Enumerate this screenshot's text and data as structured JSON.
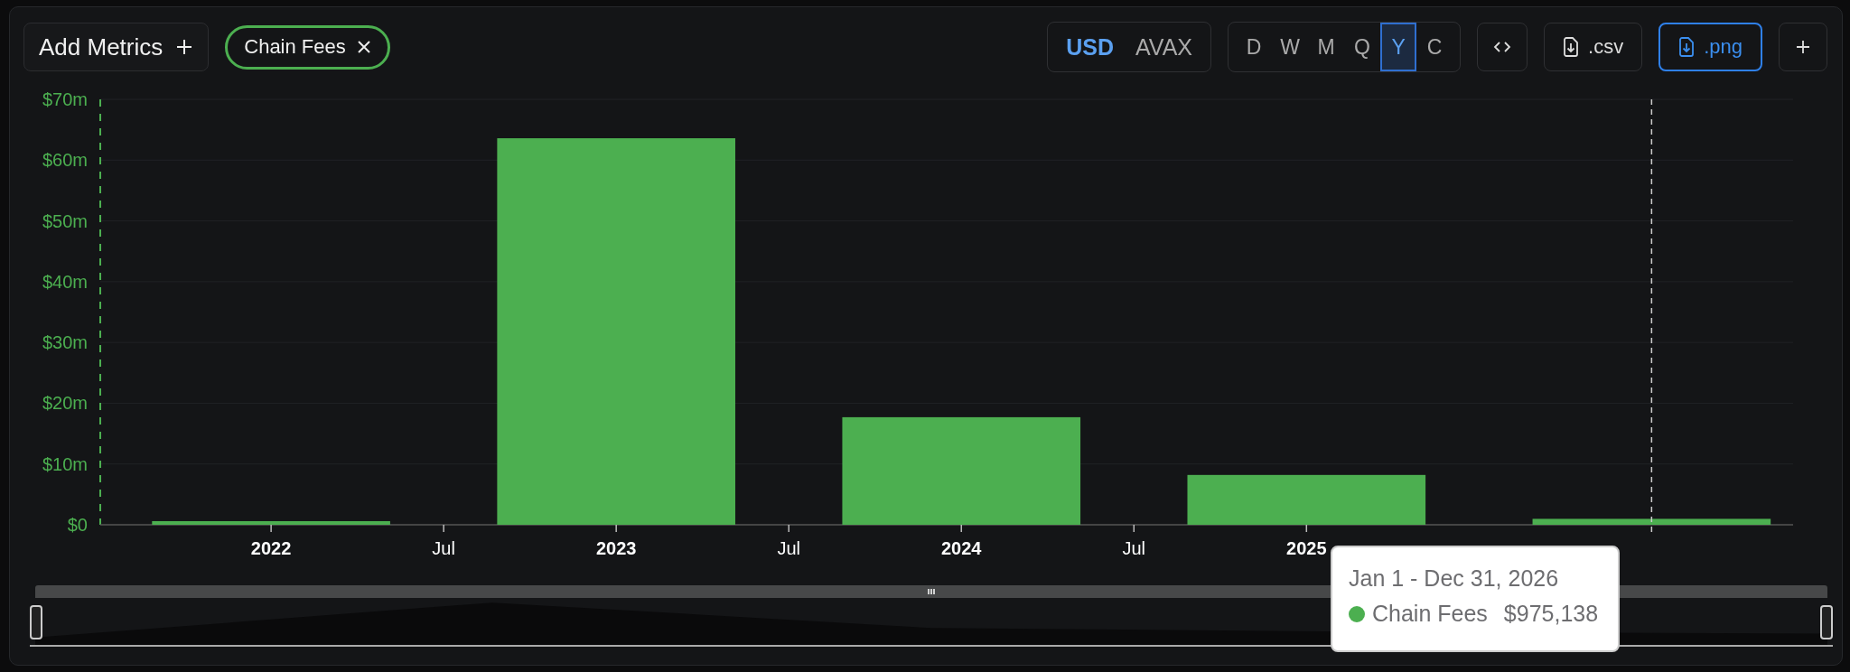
{
  "toolbar": {
    "add_metrics": {
      "label": "Add Metrics"
    },
    "metric_chips": [
      {
        "label": "Chain Fees",
        "color": "#4caf50"
      }
    ],
    "currency_toggle": [
      {
        "label": "USD",
        "selected": true
      },
      {
        "label": "AVAX",
        "selected": false
      }
    ],
    "period_toggle": [
      {
        "label": "D",
        "selected": false
      },
      {
        "label": "W",
        "selected": false
      },
      {
        "label": "M",
        "selected": false
      },
      {
        "label": "Q",
        "selected": false
      },
      {
        "label": "Y",
        "selected": true
      },
      {
        "label": "C",
        "selected": false
      }
    ],
    "actions": [
      {
        "kind": "embed",
        "selected": false
      },
      {
        "kind": "csv",
        "label": ".csv",
        "selected": false
      },
      {
        "kind": "png",
        "label": ".png",
        "selected": true
      },
      {
        "kind": "add",
        "selected": false
      }
    ]
  },
  "chart": {
    "chart_data": {
      "type": "bar",
      "x": [
        2022,
        2023,
        2024,
        2025,
        2026
      ],
      "series": [
        {
          "name": "Chain Fees",
          "color": "#4caf50",
          "values": [
            600000,
            63600000,
            17700000,
            8200000,
            975138
          ]
        }
      ],
      "grid": true,
      "xlim": [
        2021.505,
        2026.41
      ],
      "ylim": [
        0,
        70000000
      ],
      "xticks": [
        {
          "value": 2022,
          "label": "2022"
        },
        {
          "value": 2022.5,
          "label": "Jul"
        },
        {
          "value": 2023,
          "label": "2023"
        },
        {
          "value": 2023.5,
          "label": "Jul"
        },
        {
          "value": 2024,
          "label": "2024"
        },
        {
          "value": 2024.5,
          "label": "Jul"
        },
        {
          "value": 2025,
          "label": "2025"
        }
      ],
      "yticks": [
        {
          "value": 0,
          "label": "$0"
        },
        {
          "value": 10000000,
          "label": "$10m"
        },
        {
          "value": 20000000,
          "label": "$20m"
        },
        {
          "value": 30000000,
          "label": "$30m"
        },
        {
          "value": 40000000,
          "label": "$40m"
        },
        {
          "value": 50000000,
          "label": "$50m"
        },
        {
          "value": 60000000,
          "label": "$60m"
        },
        {
          "value": 70000000,
          "label": "$70m"
        }
      ],
      "ref_lines": [
        {
          "axis": "x",
          "value": 2026
        }
      ]
    },
    "tooltip": {
      "title": "Jan 1 - Dec 31, 2026",
      "values": [
        "$975,138"
      ]
    }
  }
}
